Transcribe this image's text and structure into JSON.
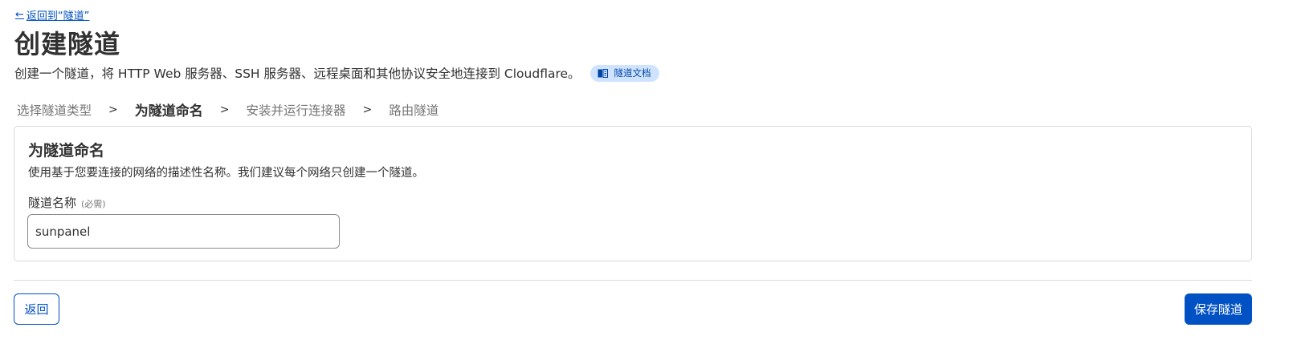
{
  "header": {
    "back_arrow": "←",
    "back_link": "返回到“隧道”",
    "title": "创建隧道",
    "subtitle": "创建一个隧道，将 HTTP Web 服务器、SSH 服务器、远程桌面和其他协议安全地连接到 Cloudflare。",
    "docs_badge": {
      "label": "隧道文档",
      "icon": "book-icon"
    }
  },
  "steps": [
    {
      "label": "选择隧道类型",
      "active": false
    },
    {
      "label": "为隧道命名",
      "active": true
    },
    {
      "label": "安装并运行连接器",
      "active": false
    },
    {
      "label": "路由隧道",
      "active": false
    }
  ],
  "step_separator": ">",
  "card": {
    "title": "为隧道命名",
    "description": "使用基于您要连接的网络的描述性名称。我们建议每个网络只创建一个隧道。",
    "field_label": "隧道名称",
    "field_required": "(必需)",
    "field_value": "sunpanel"
  },
  "footer": {
    "back_button": "返回",
    "save_button": "保存隧道"
  },
  "colors": {
    "accent": "#0051c3",
    "badge_bg": "#cfe3ff",
    "text": "#313131",
    "muted": "#757575",
    "border": "#d9d9d9"
  }
}
